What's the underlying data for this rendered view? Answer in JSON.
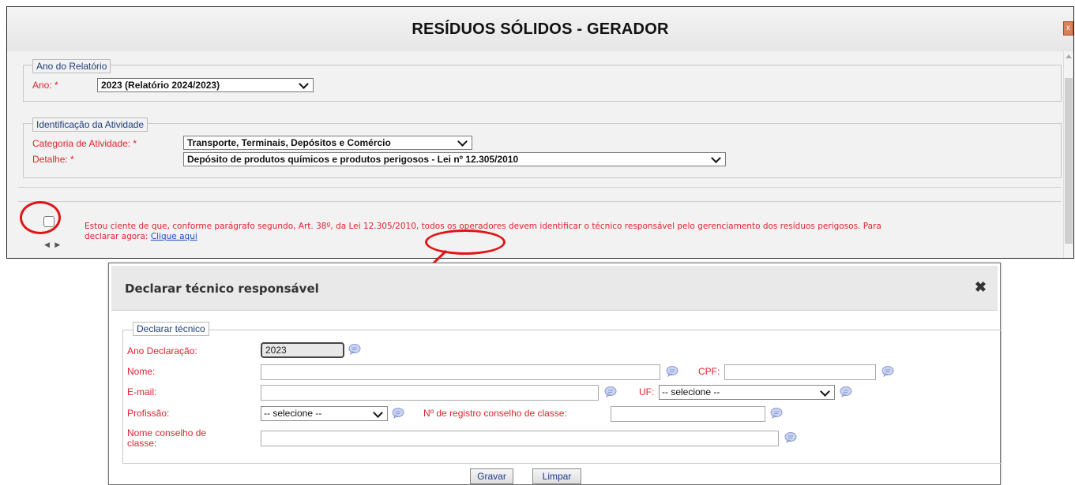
{
  "window": {
    "title": "RESÍDUOS SÓLIDOS - GERADOR",
    "close_glyph": "x"
  },
  "ano_section": {
    "legend": "Ano do Relatório",
    "label": "Ano: *",
    "selected": "2023 (Relatório 2024/2023)"
  },
  "atividade_section": {
    "legend": "Identificação da Atividade",
    "categoria_label": "Categoria de Atividade: *",
    "categoria_value": "Transporte, Terminais, Depósitos e Comércio",
    "detalhe_label": "Detalhe: *",
    "detalhe_value": "Depósito de produtos químicos e produtos perigosos - Lei nº 12.305/2010"
  },
  "notice": {
    "text": "Estou ciente de que, conforme parágrafo segundo, Art. 38º, da Lei 12.305/2010, todos os operadores devem identificar o técnico responsável pelo gerenciamento dos resíduos perigosos. Para declarar agora:",
    "link": "Clique aqui"
  },
  "modal": {
    "title": "Declarar técnico responsável",
    "close_glyph": "✖",
    "legend": "Declarar técnico",
    "fields": {
      "ano_label": "Ano Declaração:",
      "ano_value": "2023",
      "nome_label": "Nome:",
      "cpf_label": "CPF:",
      "email_label": "E-mail:",
      "uf_label": "UF:",
      "uf_selected": "-- selecione --",
      "profissao_label": "Profissão:",
      "profissao_selected": "-- selecione --",
      "registro_label": "Nº de registro conselho de classe:",
      "conselho_label_1": "Nome conselho de",
      "conselho_label_2": "classe:"
    },
    "buttons": {
      "save": "Gravar",
      "clear": "Limpar"
    }
  },
  "colors": {
    "required_label": "#e0242f",
    "legend_text": "#1f3d7a",
    "annotation": "#e01414",
    "link": "#1a4fc4"
  },
  "icons": [
    "close-icon",
    "chevron-down-icon",
    "help-bubble-icon",
    "scroll-arrow-icon"
  ]
}
